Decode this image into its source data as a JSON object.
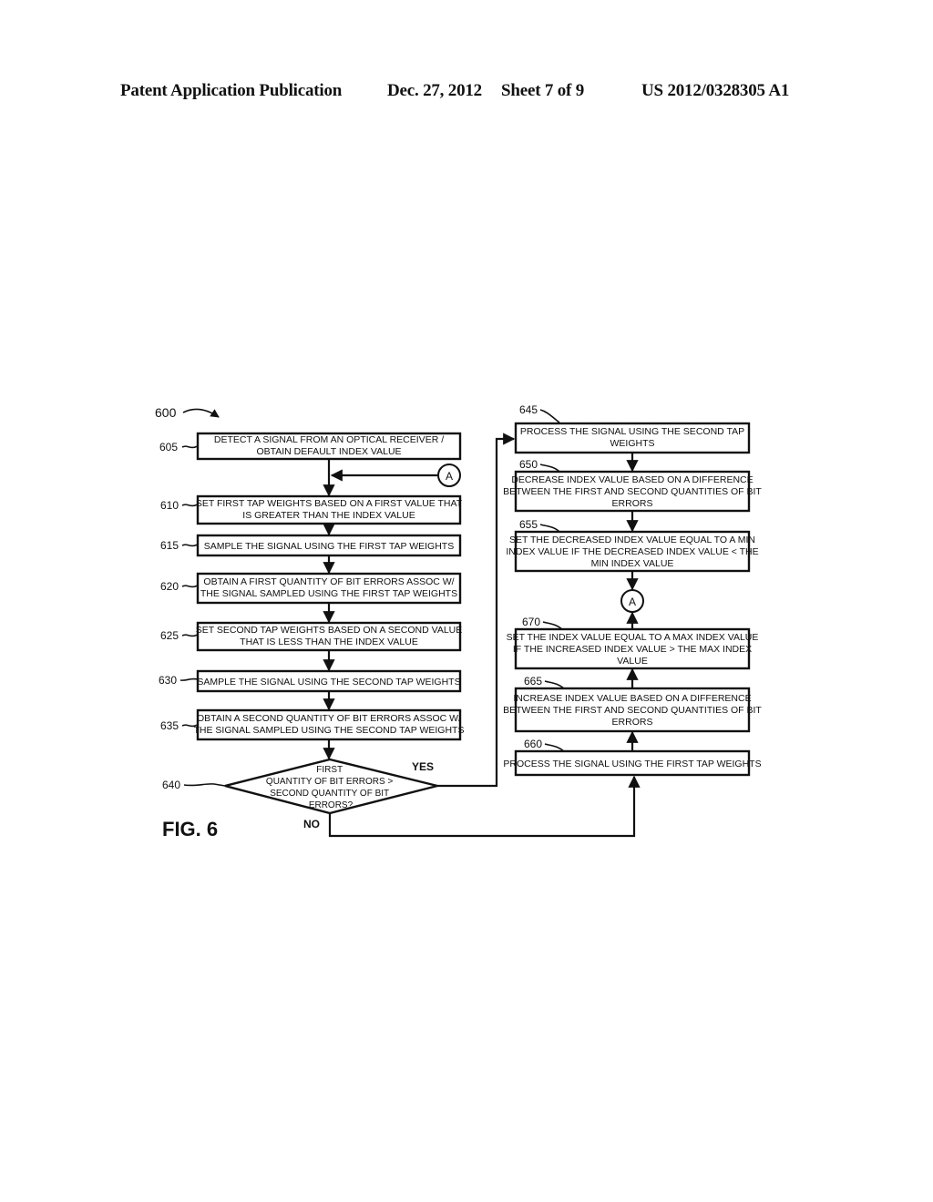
{
  "header": {
    "publication": "Patent Application Publication",
    "date": "Dec. 27, 2012",
    "sheet": "Sheet 7 of 9",
    "number": "US 2012/0328305 A1"
  },
  "figure": {
    "label": "FIG. 6",
    "ref": "600",
    "connector": "A",
    "yes_label": "YES",
    "no_label": "NO",
    "steps": {
      "s605": {
        "ref": "605",
        "lines": [
          "DETECT A SIGNAL FROM AN OPTICAL RECEIVER /",
          "OBTAIN DEFAULT INDEX VALUE"
        ]
      },
      "s610": {
        "ref": "610",
        "lines": [
          "SET FIRST TAP WEIGHTS BASED ON A FIRST VALUE THAT",
          "IS GREATER THAN THE INDEX VALUE"
        ]
      },
      "s615": {
        "ref": "615",
        "lines": [
          "SAMPLE THE SIGNAL USING THE FIRST TAP WEIGHTS"
        ]
      },
      "s620": {
        "ref": "620",
        "lines": [
          "OBTAIN A FIRST QUANTITY OF BIT ERRORS ASSOC W/",
          "THE SIGNAL SAMPLED USING THE FIRST TAP WEIGHTS"
        ]
      },
      "s625": {
        "ref": "625",
        "lines": [
          "SET SECOND TAP WEIGHTS BASED ON A SECOND VALUE",
          "THAT IS LESS THAN THE INDEX VALUE"
        ]
      },
      "s630": {
        "ref": "630",
        "lines": [
          "SAMPLE THE SIGNAL USING THE SECOND TAP WEIGHTS"
        ]
      },
      "s635": {
        "ref": "635",
        "lines": [
          "OBTAIN A SECOND QUANTITY OF BIT ERRORS ASSOC W/",
          "THE SIGNAL SAMPLED USING THE SECOND TAP WEIGHTS"
        ]
      },
      "s640": {
        "ref": "640",
        "lines": [
          "FIRST",
          "QUANTITY OF BIT ERRORS >",
          "SECOND  QUANTITY OF BIT",
          "ERRORS?"
        ]
      },
      "s645": {
        "ref": "645",
        "lines": [
          "PROCESS THE SIGNAL USING THE SECOND TAP",
          "WEIGHTS"
        ]
      },
      "s650": {
        "ref": "650",
        "lines": [
          "DECREASE INDEX VALUE BASED ON A DIFFERENCE",
          "BETWEEN THE FIRST AND SECOND QUANTITIES OF BIT",
          "ERRORS"
        ]
      },
      "s655": {
        "ref": "655",
        "lines": [
          "SET THE DECREASED INDEX VALUE EQUAL TO A MIN",
          "INDEX VALUE IF THE DECREASED INDEX VALUE < THE",
          "MIN INDEX VALUE"
        ]
      },
      "s660": {
        "ref": "660",
        "lines": [
          "PROCESS THE SIGNAL USING THE FIRST TAP WEIGHTS"
        ]
      },
      "s665": {
        "ref": "665",
        "lines": [
          "INCREASE INDEX VALUE BASED ON A DIFFERENCE",
          "BETWEEN THE FIRST AND SECOND QUANTITIES OF BIT",
          "ERRORS"
        ]
      },
      "s670": {
        "ref": "670",
        "lines": [
          "SET THE INDEX VALUE EQUAL TO A MAX INDEX VALUE",
          "IF THE INCREASED INDEX VALUE > THE MAX INDEX",
          "VALUE"
        ]
      }
    }
  }
}
